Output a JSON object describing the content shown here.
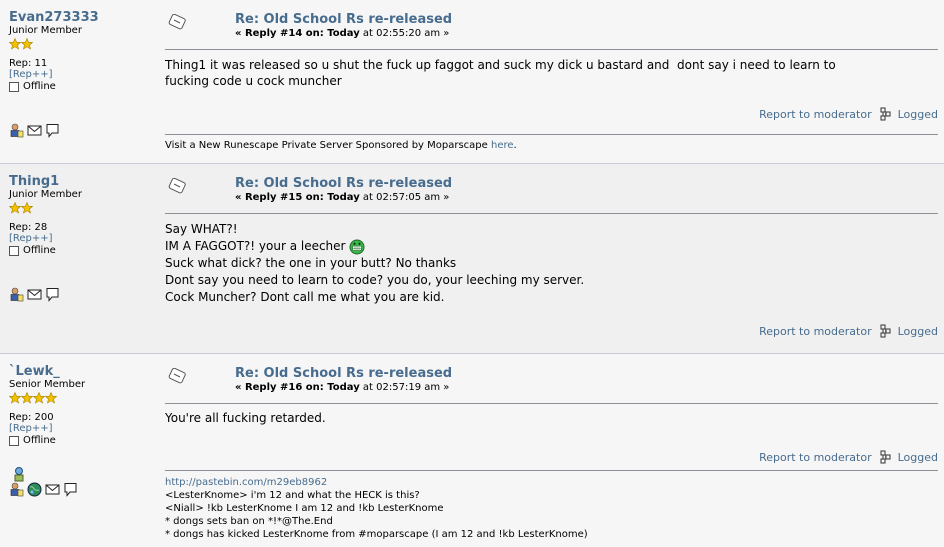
{
  "posts": [
    {
      "username": "Evan273333",
      "rank": "Junior Member",
      "stars": 2,
      "rep": "Rep: 11",
      "rep_link": "[Rep++]",
      "status": "Offline",
      "subject": "Re: Old School Rs re-released",
      "reply_label": "« Reply #14 on: Today",
      "time": " at 02:55:20 am »",
      "lines": [
        "Thing1 it was released so u shut the fuck up faggot and suck my dick u bastard and  dont say i need to learn to",
        "fucking code u cock muncher"
      ],
      "report": "Report to moderator",
      "logged": "Logged",
      "signature_text": "Visit a New Runescape Private Server Sponsored by Moparscape ",
      "signature_link": "here",
      "signature_end": "."
    },
    {
      "username": "Thing1",
      "rank": "Junior Member",
      "stars": 2,
      "rep": "Rep: 28",
      "rep_link": "[Rep++]",
      "status": "Offline",
      "subject": "Re: Old School Rs re-released",
      "reply_label": "« Reply #15 on: Today",
      "time": " at 02:57:05 am »",
      "lines": [
        "Say WHAT?!",
        "IM A FAGGOT?! your a leecher ",
        "Suck what dick? the one in your butt? No thanks",
        "Dont say you need to learn to code? you do, your leeching my server.",
        "Cock Muncher? Dont call me what you are kid."
      ],
      "report": "Report to moderator",
      "logged": "Logged"
    },
    {
      "username": "`Lewk_",
      "rank": "Senior Member",
      "stars": 4,
      "rep": "Rep: 200",
      "rep_link": "[Rep++]",
      "status": "Offline",
      "subject": "Re: Old School Rs re-released",
      "reply_label": "« Reply #16 on: Today",
      "time": " at 02:57:19 am »",
      "lines": [
        "You're all fucking retarded."
      ],
      "report": "Report to moderator",
      "logged": "Logged",
      "sig_link": "http://pastebin.com/m29eb8962",
      "sig_lines": [
        "<LesterKnome> i'm 12 and what the HECK is this?",
        "<Niall> !kb LesterKnome I am 12 and !kb LesterKnome",
        "* dongs sets ban on *!*@The.End",
        "* dongs has kicked LesterKnome from #moparscape (I am 12 and !kb LesterKnome)"
      ]
    }
  ],
  "colors": {
    "link": "#476c8e",
    "star": "#f2c200"
  }
}
